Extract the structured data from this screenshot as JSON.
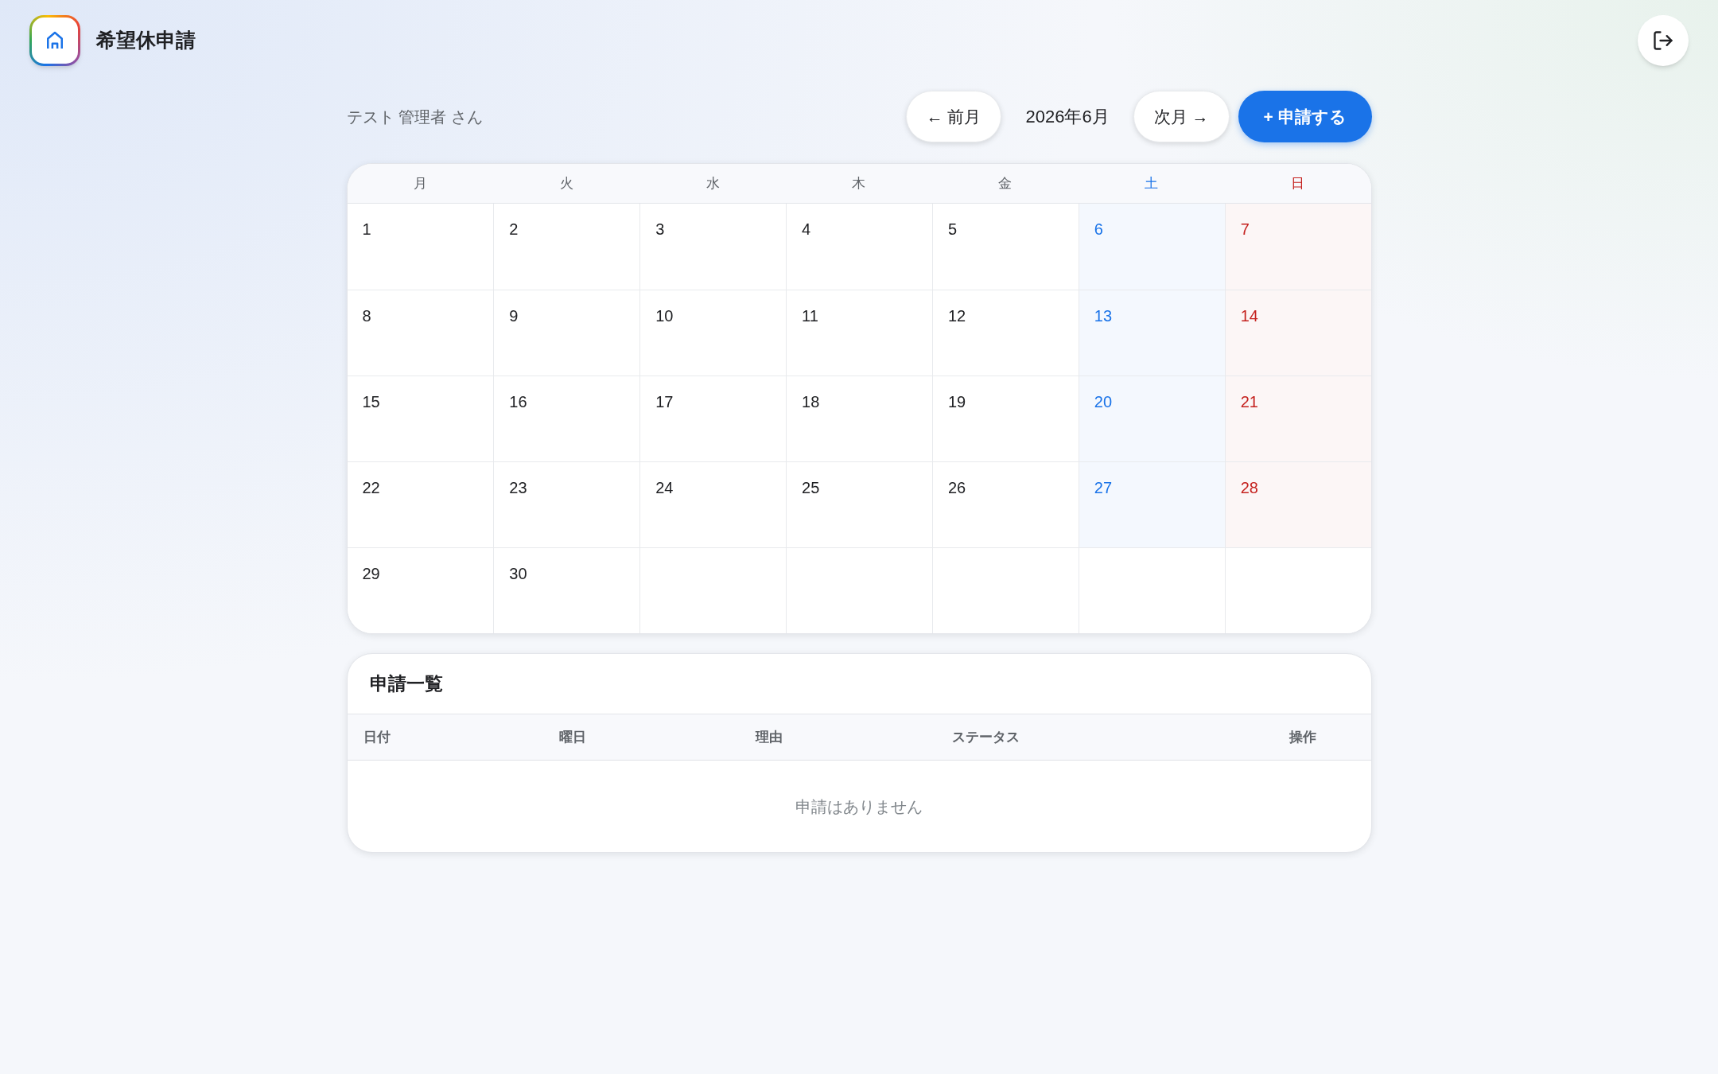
{
  "app": {
    "title": "希望休申請"
  },
  "toolbar": {
    "user_name": "テスト 管理者 さん",
    "prev_button": "← 前月",
    "month": "2026年6月",
    "next_button": "次月 →",
    "apply_button": "+ 申請する"
  },
  "calendar": {
    "weekdays": [
      {
        "label": "月",
        "kind": "weekday"
      },
      {
        "label": "火",
        "kind": "weekday"
      },
      {
        "label": "水",
        "kind": "weekday"
      },
      {
        "label": "木",
        "kind": "weekday"
      },
      {
        "label": "金",
        "kind": "weekday"
      },
      {
        "label": "土",
        "kind": "saturday"
      },
      {
        "label": "日",
        "kind": "sunday"
      }
    ],
    "weeks": [
      [
        "1",
        "2",
        "3",
        "4",
        "5",
        "6",
        "7"
      ],
      [
        "8",
        "9",
        "10",
        "11",
        "12",
        "13",
        "14"
      ],
      [
        "15",
        "16",
        "17",
        "18",
        "19",
        "20",
        "21"
      ],
      [
        "22",
        "23",
        "24",
        "25",
        "26",
        "27",
        "28"
      ],
      [
        "29",
        "30"
      ]
    ]
  },
  "requests": {
    "title": "申請一覧",
    "columns": [
      "日付",
      "曜日",
      "理由",
      "ステータス",
      "操作"
    ],
    "empty_message": "申請はありません"
  }
}
